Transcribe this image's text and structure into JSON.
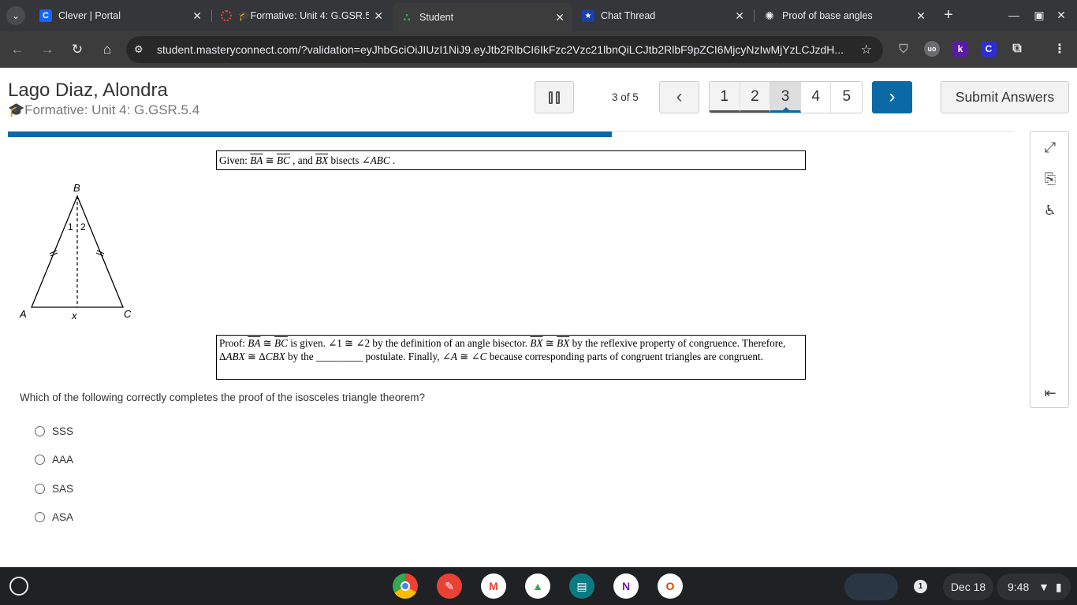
{
  "browser": {
    "tabs": [
      {
        "title": "Clever | Portal",
        "icon": "C",
        "icon_bg": "#1464ff"
      },
      {
        "title": "🎓Formative: Unit 4: G.GSR.5",
        "icon": "○",
        "icon_bg": "transparent"
      },
      {
        "title": "Student",
        "icon": "∴",
        "icon_bg": "transparent"
      },
      {
        "title": "Chat Thread",
        "icon": "★",
        "icon_bg": "transparent"
      },
      {
        "title": "Proof of base angles",
        "icon": "✺",
        "icon_bg": "transparent"
      }
    ],
    "active_tab": 2,
    "url": "student.masteryconnect.com/?validation=eyJhbGciOiJIUzI1NiJ9.eyJtb2RlbCI6IkFzc2Vzc21lbnQiLCJtb2RlbF9pZCI6MjcyNzIwMjYzLCJzdH...",
    "ext_k": "k",
    "ext_c": "C"
  },
  "header": {
    "student_name": "Lago Diaz, Alondra",
    "assessment_title": "🎓Formative: Unit 4: G.GSR.5.4",
    "counter": "3 of 5",
    "pages": [
      "1",
      "2",
      "3",
      "4",
      "5"
    ],
    "current_page": 3,
    "submit_label": "Submit Answers",
    "progress": 0.6
  },
  "question": {
    "figure_labels": {
      "b": "B",
      "a": "A",
      "c": "C",
      "x": "x",
      "angle1": "1",
      "angle2": "2"
    },
    "prompt": "Which of the following correctly completes the proof of the isosceles triangle theorem?",
    "choices": [
      "SSS",
      "AAA",
      "SAS",
      "ASA"
    ]
  },
  "shelf": {
    "date": "Dec 18",
    "time": "9:48",
    "notification_count": "1"
  }
}
